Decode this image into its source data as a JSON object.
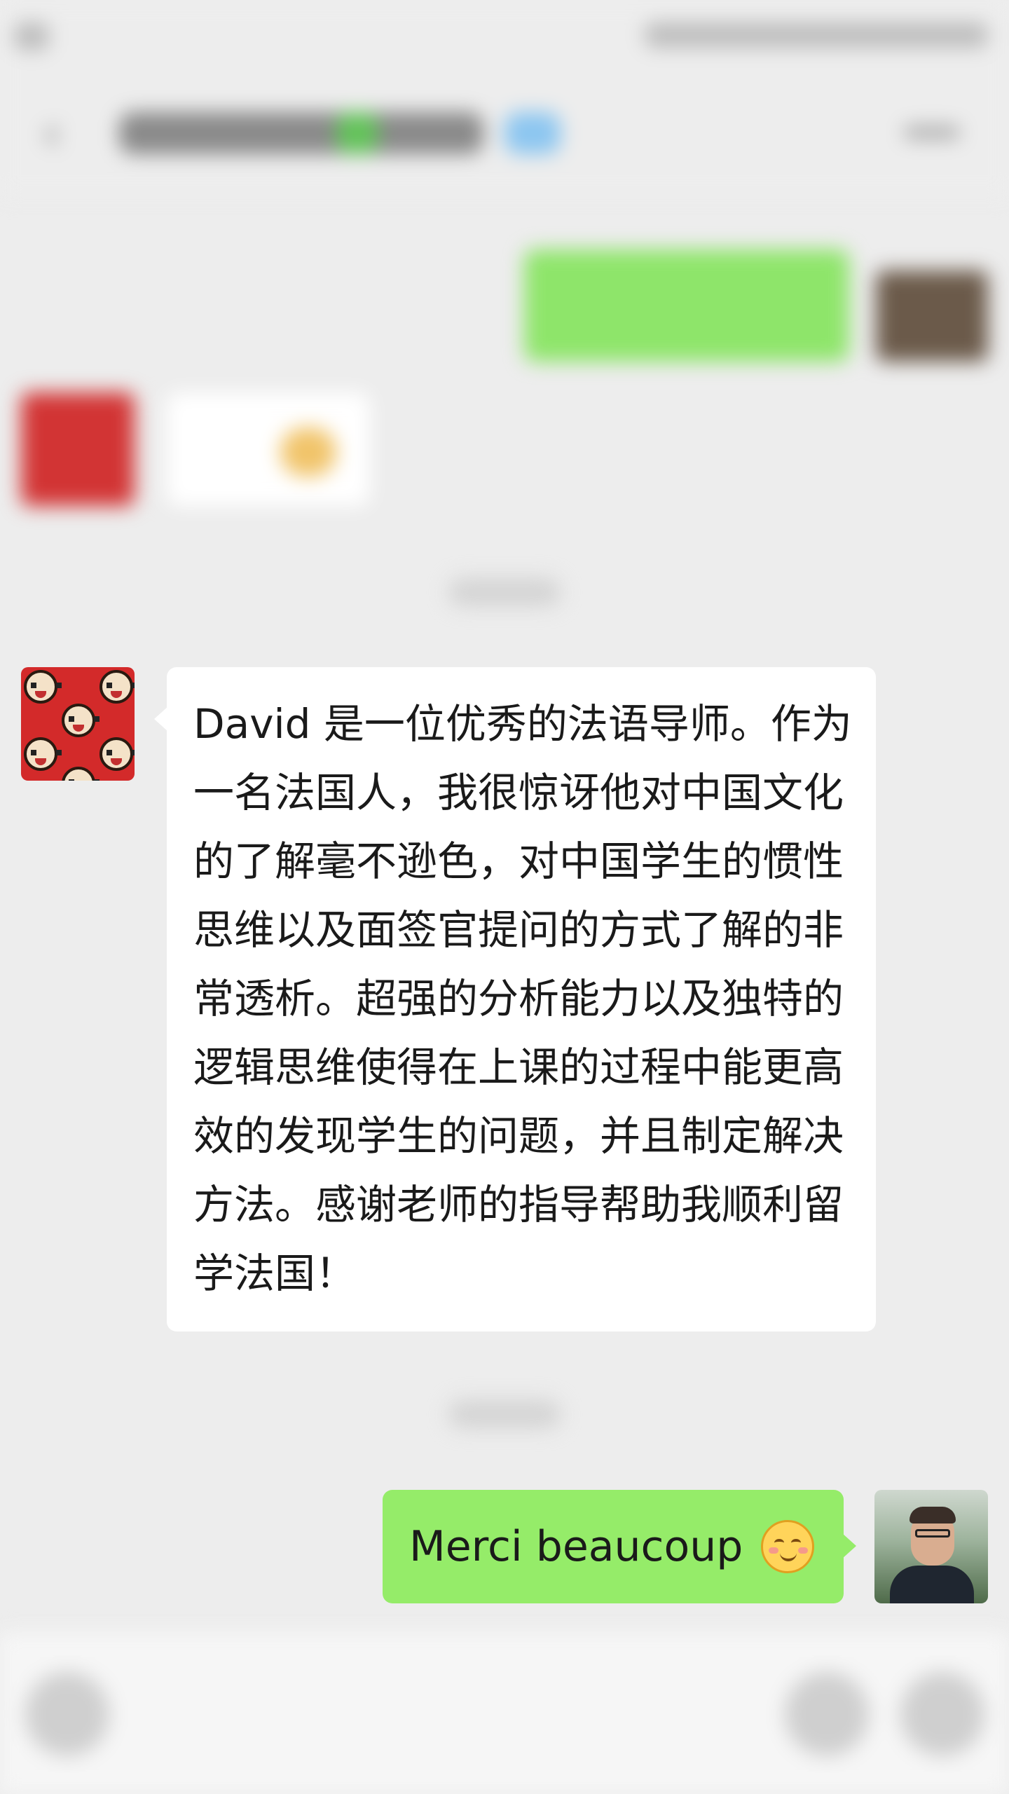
{
  "conversation": {
    "received_message": {
      "text": "David 是一位优秀的法语导师。作为一名法国人，我很惊讶他对中国文化的了解毫不逊色，对中国学生的惯性思维以及面签官提问的方式了解的非常透析。超强的分析能力以及独特的逻辑思维使得在上课的过程中能更高效的发现学生的问题，并且制定解决方法。感谢老师的指导帮助我顺利留学法国！",
      "avatar_icon": "cartoon-faces-avatar"
    },
    "sent_message": {
      "text": "Merci beaucoup",
      "emoji_icon": "smiling-blush-emoji",
      "avatar_icon": "user-photo-avatar"
    }
  },
  "colors": {
    "background": "#ededed",
    "sent_bubble": "#95ec69",
    "received_bubble": "#ffffff",
    "received_avatar": "#d32a2a"
  }
}
